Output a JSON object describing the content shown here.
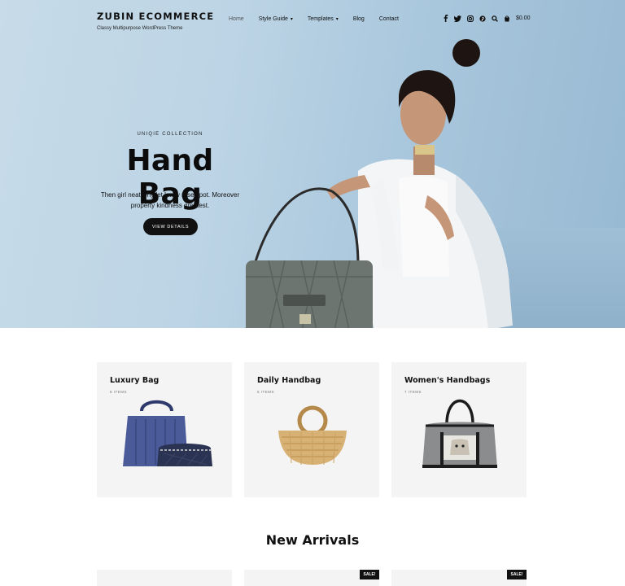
{
  "header": {
    "brand_title": "ZUBIN ECOMMERCE",
    "brand_tagline": "Classy Multipurpose WordPress Theme",
    "nav": [
      {
        "label": "Home"
      },
      {
        "label": "Style Guide"
      },
      {
        "label": "Templates"
      },
      {
        "label": "Blog"
      },
      {
        "label": "Contact"
      }
    ],
    "icons": [
      "facebook-icon",
      "twitter-icon",
      "instagram-icon",
      "pinterest-icon",
      "search-icon",
      "cart-icon"
    ],
    "cart_total": "$0.00"
  },
  "hero": {
    "kicker": "UNIQIE COLLECTION",
    "title": "Hand Bag",
    "description": "Then girl neat why let knew rose spot. Moreover property kindness greatest.",
    "button_label": "VIEW DETAILS"
  },
  "categories": [
    {
      "title": "Luxury Bag",
      "count": "8 ITEMS"
    },
    {
      "title": "Daily Handbag",
      "count": "5 ITEMS"
    },
    {
      "title": "Women's Handbags",
      "count": "7 ITEMS"
    }
  ],
  "new_arrivals": {
    "title": "New Arrivals",
    "products": [
      {
        "badge": ""
      },
      {
        "badge": "SALE!"
      },
      {
        "badge": "SALE!"
      }
    ]
  },
  "colors": {
    "accent": "#111111",
    "hero_bg": "#b8d0e2",
    "card_bg": "#f4f4f4"
  }
}
